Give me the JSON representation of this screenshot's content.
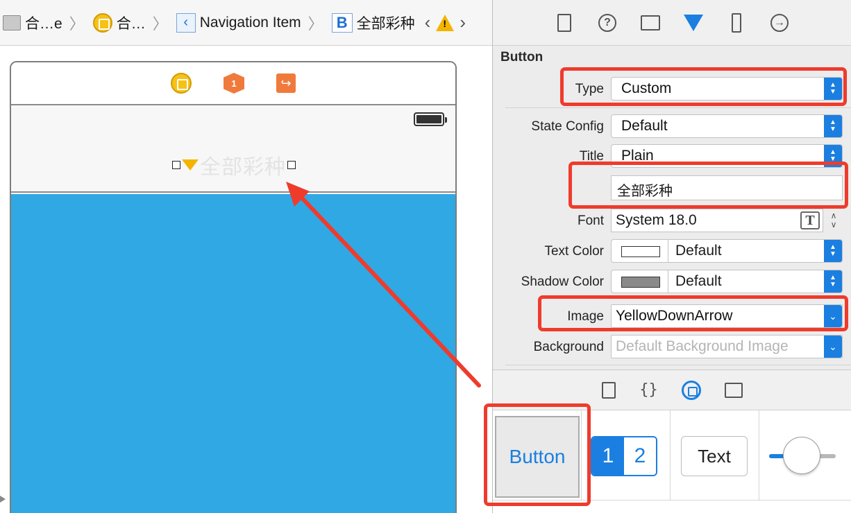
{
  "jumpbar": {
    "crumbs": [
      "合…e",
      "合…",
      "Navigation Item",
      "全部彩种"
    ],
    "item_b_letter": "B"
  },
  "scene": {
    "title_text": "全部彩种",
    "cube_number": "1",
    "content_color": "#2fa8e4"
  },
  "inspector": {
    "section_title": "Button",
    "type": {
      "label": "Type",
      "value": "Custom"
    },
    "state_config": {
      "label": "State Config",
      "value": "Default"
    },
    "title": {
      "label": "Title",
      "value": "Plain",
      "text": "全部彩种"
    },
    "font": {
      "label": "Font",
      "value": "System 18.0"
    },
    "text_color": {
      "label": "Text Color",
      "value": "Default",
      "swatch": "#ffffff"
    },
    "shadow_color": {
      "label": "Shadow Color",
      "value": "Default",
      "swatch": "#8a8a8a"
    },
    "image": {
      "label": "Image",
      "value": "YellowDownArrow"
    },
    "background": {
      "label": "Background",
      "placeholder": "Default Background Image"
    }
  },
  "library": {
    "button_label": "Button",
    "segment_1": "1",
    "segment_2": "2",
    "textfield_label": "Text"
  },
  "colors": {
    "accent": "#1a7fe0",
    "annotation": "#ef3b2c"
  }
}
